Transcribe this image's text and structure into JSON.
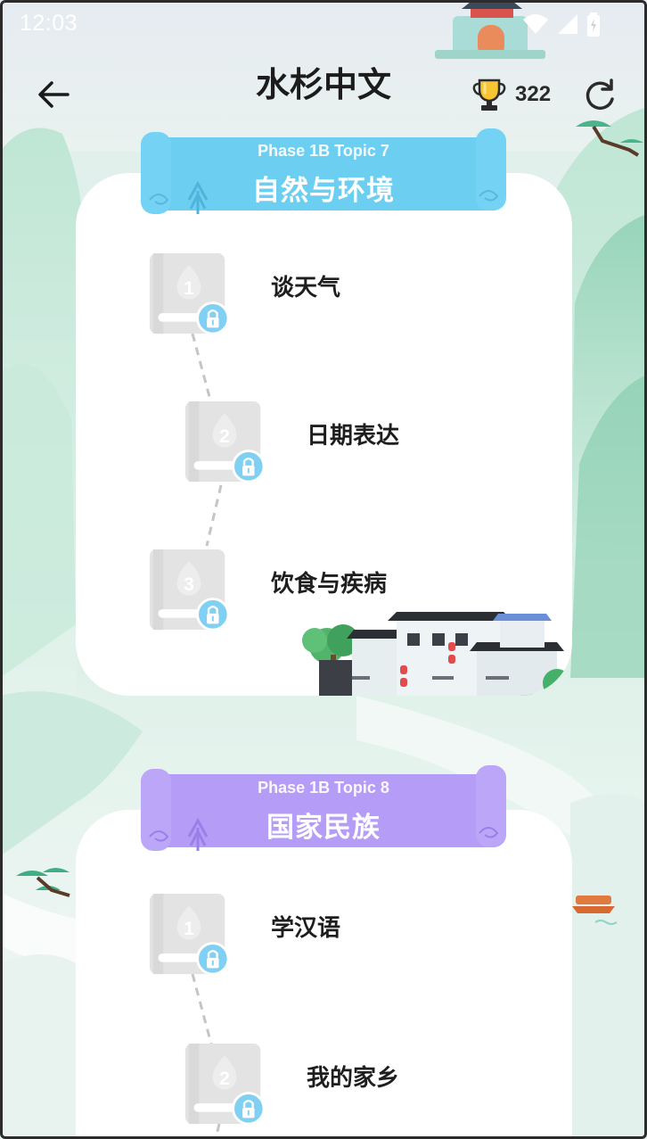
{
  "status_bar": {
    "time": "12:03"
  },
  "header": {
    "title": "水杉中文",
    "trophy_count": "322"
  },
  "topics": [
    {
      "subtitle": "Phase 1B Topic 7",
      "title": "自然与环境",
      "ribbon_color": "#6ccff2",
      "lessons": [
        {
          "number": "1",
          "label": "谈天气",
          "locked": true
        },
        {
          "number": "2",
          "label": "日期表达",
          "locked": true
        },
        {
          "number": "3",
          "label": "饮食与疾病",
          "locked": true
        }
      ]
    },
    {
      "subtitle": "Phase 1B Topic 8",
      "title": "国家民族",
      "ribbon_color": "#b49cf7",
      "lessons": [
        {
          "number": "1",
          "label": "学汉语",
          "locked": true
        },
        {
          "number": "2",
          "label": "我的家乡",
          "locked": true
        }
      ]
    }
  ],
  "colors": {
    "lock_badge": "#7fd0f2",
    "book_gray": "#e3e3e3",
    "accent_mountain": "#a9dcc4"
  }
}
